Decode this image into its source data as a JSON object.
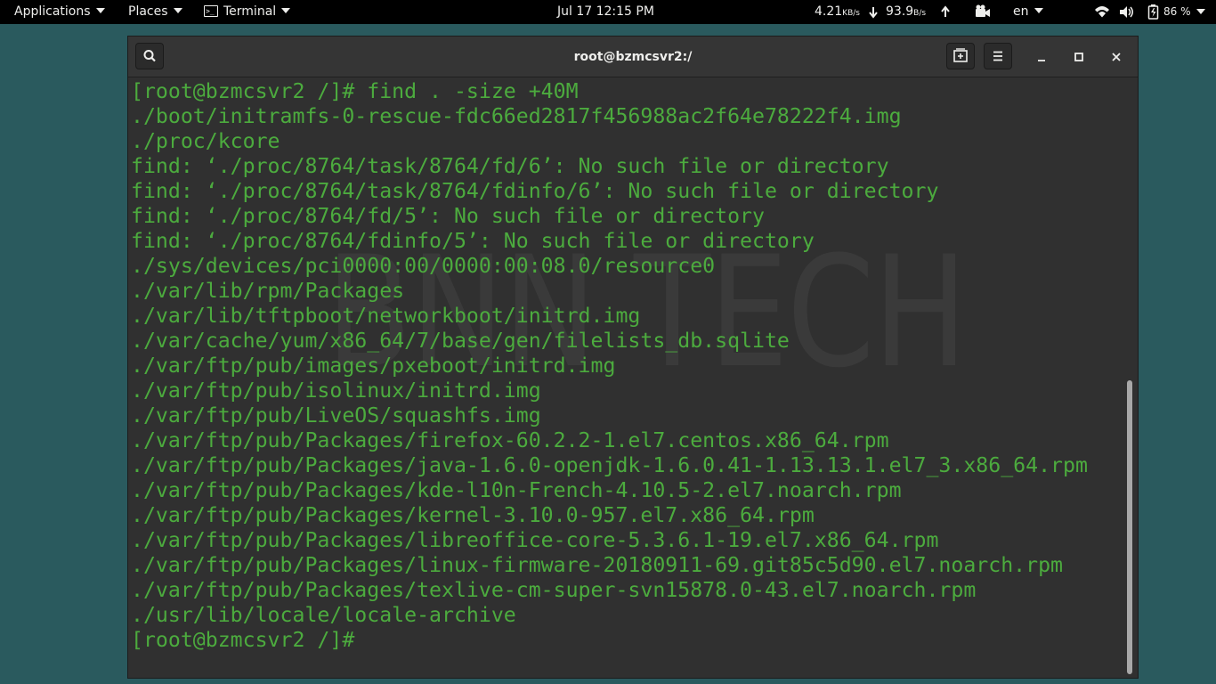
{
  "topbar": {
    "applications": "Applications",
    "places": "Places",
    "terminal": "Terminal",
    "clock": "Jul 17  12:15 PM",
    "net_down_value": "4.21",
    "net_down_unit": "KB/s",
    "net_up_value": "93.9",
    "net_up_unit": "B/s",
    "language": "en",
    "battery": "86 %"
  },
  "window": {
    "title": "root@bzmcsvr2:/"
  },
  "watermark": "BNN TECH",
  "terminal": {
    "lines": [
      "[root@bzmcsvr2 /]# find . -size +40M",
      "./boot/initramfs-0-rescue-fdc66ed2817f456988ac2f64e78222f4.img",
      "./proc/kcore",
      "find: ‘./proc/8764/task/8764/fd/6’: No such file or directory",
      "find: ‘./proc/8764/task/8764/fdinfo/6’: No such file or directory",
      "find: ‘./proc/8764/fd/5’: No such file or directory",
      "find: ‘./proc/8764/fdinfo/5’: No such file or directory",
      "./sys/devices/pci0000:00/0000:00:08.0/resource0",
      "./var/lib/rpm/Packages",
      "./var/lib/tftpboot/networkboot/initrd.img",
      "./var/cache/yum/x86_64/7/base/gen/filelists_db.sqlite",
      "./var/ftp/pub/images/pxeboot/initrd.img",
      "./var/ftp/pub/isolinux/initrd.img",
      "./var/ftp/pub/LiveOS/squashfs.img",
      "./var/ftp/pub/Packages/firefox-60.2.2-1.el7.centos.x86_64.rpm",
      "./var/ftp/pub/Packages/java-1.6.0-openjdk-1.6.0.41-1.13.13.1.el7_3.x86_64.rpm",
      "./var/ftp/pub/Packages/kde-l10n-French-4.10.5-2.el7.noarch.rpm",
      "./var/ftp/pub/Packages/kernel-3.10.0-957.el7.x86_64.rpm",
      "./var/ftp/pub/Packages/libreoffice-core-5.3.6.1-19.el7.x86_64.rpm",
      "./var/ftp/pub/Packages/linux-firmware-20180911-69.git85c5d90.el7.noarch.rpm",
      "./var/ftp/pub/Packages/texlive-cm-super-svn15878.0-43.el7.noarch.rpm",
      "./usr/lib/locale/locale-archive"
    ],
    "prompt": "[root@bzmcsvr2 /]#"
  },
  "colors": {
    "terminal_text": "#4cab3e",
    "terminal_bg": "#303030",
    "desktop_bg": "#2a5a5e",
    "topbar_bg": "#000000"
  }
}
